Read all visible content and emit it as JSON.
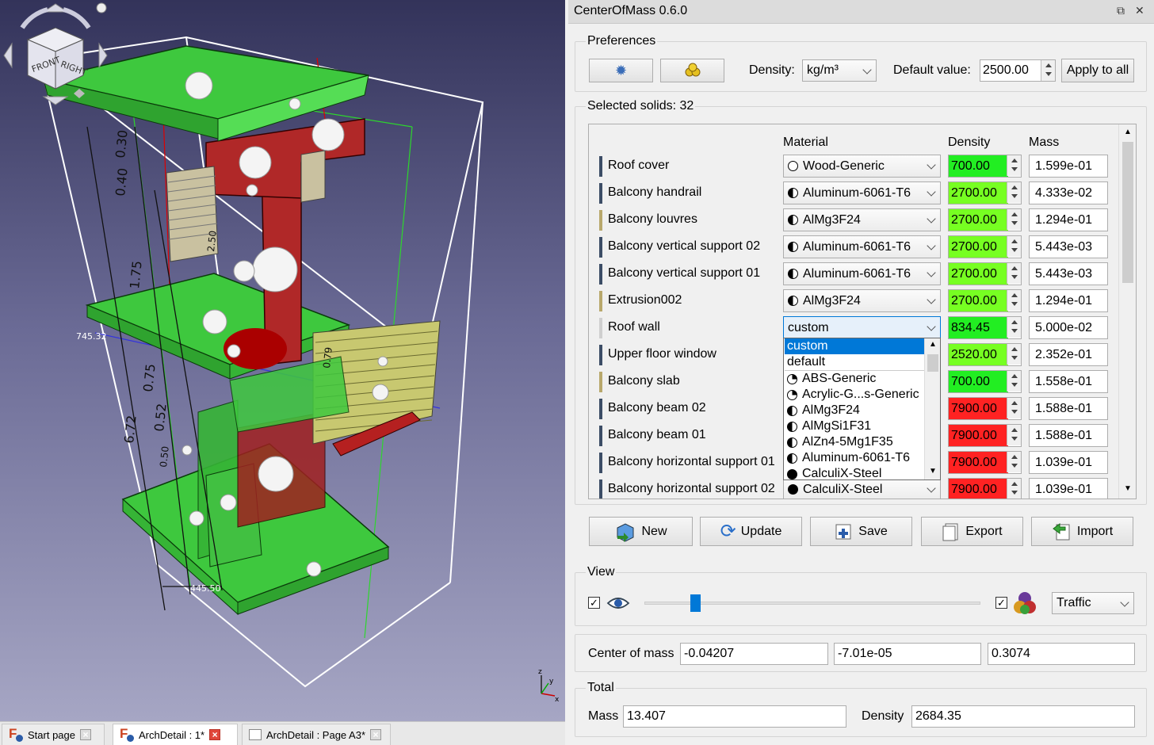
{
  "viewport": {
    "dim_labels": [
      "0.40",
      "0.30",
      "1.75",
      "0.52",
      "0.75",
      "6.72",
      "0.50",
      "2.50",
      "0.79"
    ],
    "dim_x1": "745.32",
    "dim_x2": "445.50",
    "axes": {
      "x": "x",
      "y": "y",
      "z": "z"
    }
  },
  "tabs": [
    {
      "label": "Start page"
    },
    {
      "label": "ArchDetail : 1*"
    },
    {
      "label": "ArchDetail : Page A3*"
    }
  ],
  "panel": {
    "title": "CenterOfMass 0.6.0",
    "preferences": {
      "label": "Preferences",
      "density_label": "Density:",
      "density_unit": "kg/m³",
      "default_label": "Default value:",
      "default_value": "2500.00",
      "apply_label": "Apply to all"
    },
    "selected_label": "Selected solids: 32",
    "columns": {
      "material": "Material",
      "density": "Density",
      "mass": "Mass"
    },
    "rows": [
      {
        "name": "Roof cover",
        "material": "Wood-Generic",
        "icon": "empty",
        "density": "700.00",
        "mass": "1.599e-01",
        "dcolor": "#22ee22",
        "bar": "#3c4d66"
      },
      {
        "name": "Balcony handrail",
        "material": "Aluminum-6061-T6",
        "icon": "half",
        "density": "2700.00",
        "mass": "4.333e-02",
        "dcolor": "#77ff22",
        "bar": "#3c4d66"
      },
      {
        "name": "Balcony louvres",
        "material": "AlMg3F24",
        "icon": "half",
        "density": "2700.00",
        "mass": "1.294e-01",
        "dcolor": "#77ff22",
        "bar": "#b8a86c"
      },
      {
        "name": "Balcony vertical support 02",
        "material": "Aluminum-6061-T6",
        "icon": "half",
        "density": "2700.00",
        "mass": "5.443e-03",
        "dcolor": "#77ff22",
        "bar": "#3c4d66"
      },
      {
        "name": "Balcony vertical support 01",
        "material": "Aluminum-6061-T6",
        "icon": "half",
        "density": "2700.00",
        "mass": "5.443e-03",
        "dcolor": "#77ff22",
        "bar": "#3c4d66"
      },
      {
        "name": "Extrusion002",
        "material": "AlMg3F24",
        "icon": "half",
        "density": "2700.00",
        "mass": "1.294e-01",
        "dcolor": "#77ff22",
        "bar": "#b8a86c"
      },
      {
        "name": "Roof wall",
        "material": "custom",
        "icon": "none",
        "density": "834.45",
        "mass": "5.000e-02",
        "dcolor": "#22ee22",
        "bar": "#cfcfcf"
      },
      {
        "name": "Upper floor window",
        "material": "",
        "icon": "none",
        "density": "2520.00",
        "mass": "2.352e-01",
        "dcolor": "#77ff22",
        "bar": "#3c4d66"
      },
      {
        "name": "Balcony slab",
        "material": "",
        "icon": "none",
        "density": "700.00",
        "mass": "1.558e-01",
        "dcolor": "#22ee22",
        "bar": "#b8a86c"
      },
      {
        "name": "Balcony beam 02",
        "material": "",
        "icon": "none",
        "density": "7900.00",
        "mass": "1.588e-01",
        "dcolor": "#ff2222",
        "bar": "#3c4d66"
      },
      {
        "name": "Balcony beam 01",
        "material": "",
        "icon": "none",
        "density": "7900.00",
        "mass": "1.588e-01",
        "dcolor": "#ff2222",
        "bar": "#3c4d66"
      },
      {
        "name": "Balcony horizontal support 01",
        "material": "",
        "icon": "none",
        "density": "7900.00",
        "mass": "1.039e-01",
        "dcolor": "#ff2222",
        "bar": "#3c4d66"
      },
      {
        "name": "Balcony horizontal support 02",
        "material": "CalculiX-Steel",
        "icon": "full",
        "density": "7900.00",
        "mass": "1.039e-01",
        "dcolor": "#ff2222",
        "bar": "#3c4d66"
      }
    ],
    "dropdown_options": [
      {
        "label": "custom",
        "icon": "none"
      },
      {
        "label": "default",
        "icon": "none"
      },
      {
        "label": "ABS-Generic",
        "icon": "quarter"
      },
      {
        "label": "Acrylic-G...s-Generic",
        "icon": "quarter"
      },
      {
        "label": "AlMg3F24",
        "icon": "half"
      },
      {
        "label": "AlMgSi1F31",
        "icon": "half"
      },
      {
        "label": "AlZn4-5Mg1F35",
        "icon": "half"
      },
      {
        "label": "Aluminum-6061-T6",
        "icon": "half"
      },
      {
        "label": "CalculiX-Steel",
        "icon": "full"
      }
    ],
    "buttons": {
      "new": "New",
      "update": "Update",
      "save": "Save",
      "export": "Export",
      "import": "Import"
    },
    "view": {
      "label": "View",
      "colormap": "Traffic",
      "slider_fraction": 0.15,
      "show_checked": true,
      "color_checked": true
    },
    "center_of_mass": {
      "label": "Center of mass",
      "x": "-0.04207",
      "y": "-7.01e-05",
      "z": "0.3074"
    },
    "total": {
      "label": "Total",
      "mass_label": "Mass",
      "mass": "13.407",
      "density_label": "Density",
      "density": "2684.35"
    }
  }
}
